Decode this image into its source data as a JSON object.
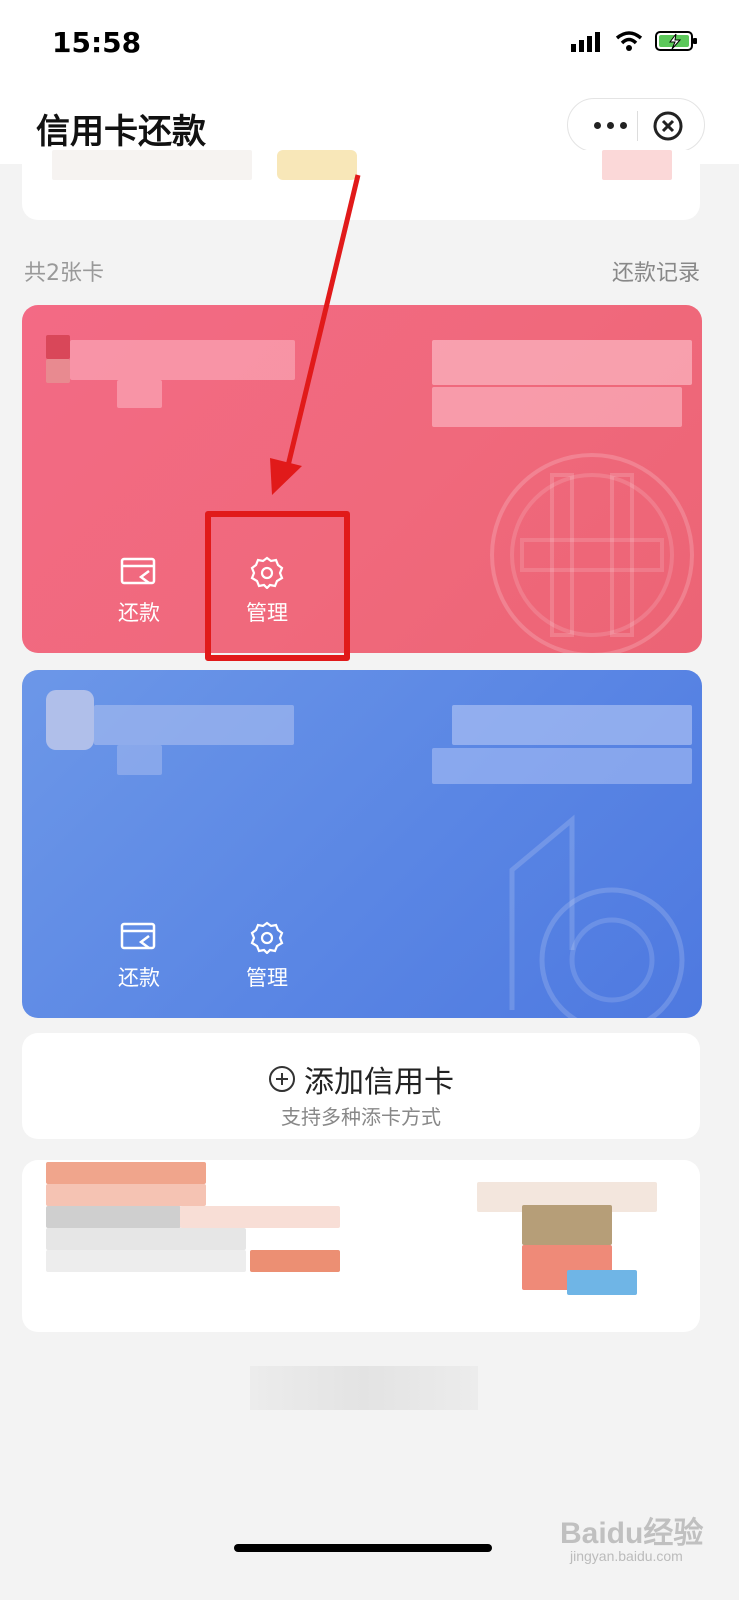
{
  "status": {
    "time": "15:58"
  },
  "nav": {
    "title": "信用卡还款"
  },
  "cards_section": {
    "count_label": "共2张卡",
    "history_link": "还款记录"
  },
  "cards": [
    {
      "bank_color": "#f0697c",
      "actions": {
        "repay": "还款",
        "manage": "管理"
      }
    },
    {
      "bank_color": "#5a86e4",
      "actions": {
        "repay": "还款",
        "manage": "管理"
      }
    }
  ],
  "add_card": {
    "title": "添加信用卡",
    "subtitle": "支持多种添卡方式"
  },
  "watermark": {
    "brand": "Baidu经验",
    "url": "jingyan.baidu.com"
  },
  "colors": {
    "accent_red": "#e11a1a",
    "card_red": "#f0697c",
    "card_blue": "#5a86e4",
    "background": "#f3f3f3"
  },
  "icons": [
    "signal-icon",
    "wifi-icon",
    "battery-charging-icon",
    "more-icon",
    "close-circle-icon",
    "repay-card-icon",
    "gear-icon",
    "add-circle-icon"
  ]
}
